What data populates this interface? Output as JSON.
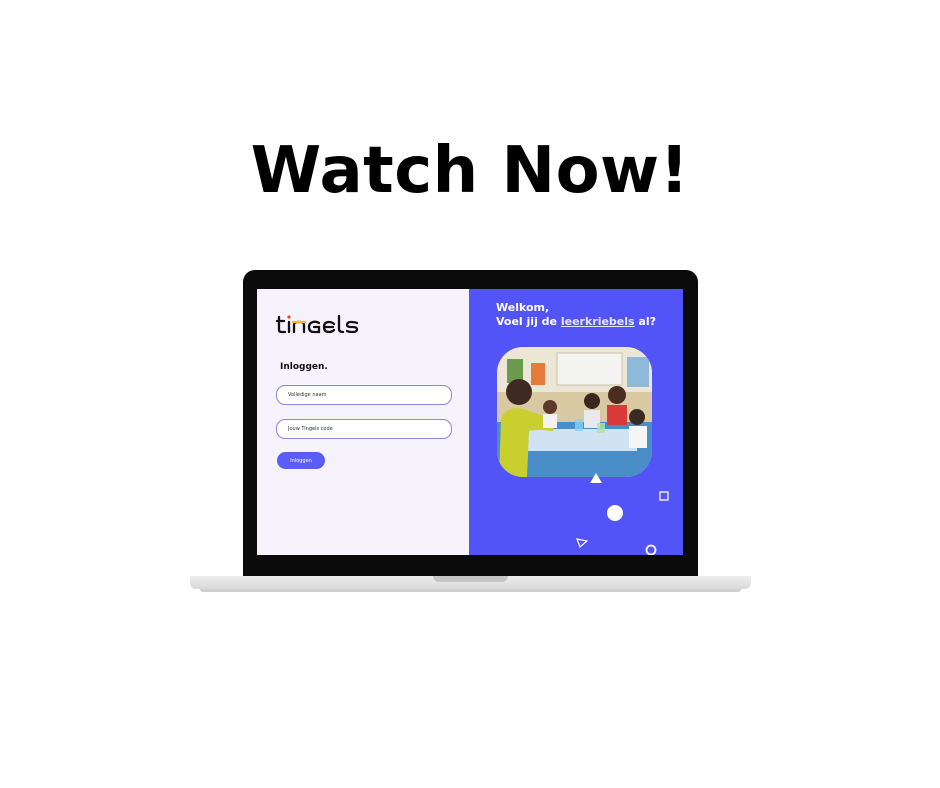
{
  "headline": "Watch Now!",
  "app": {
    "logo_text": "tingels",
    "login_title": "Inloggen.",
    "name_placeholder": "Volledige naam",
    "code_placeholder": "Jouw Tingels code",
    "login_button": "Inloggen"
  },
  "hero": {
    "line1": "Welkom,",
    "line2_prefix": "Voel jij de ",
    "line2_highlight": "leerkriebels",
    "line2_suffix": " al?"
  },
  "colors": {
    "accent": "#5354f8",
    "left_background": "#f6f3fc",
    "button": "#5b5ef6",
    "headline": "#000000"
  },
  "icons": [
    "triangle-icon",
    "square-icon",
    "circle-icon",
    "triangle-outline-icon",
    "ring-icon"
  ]
}
